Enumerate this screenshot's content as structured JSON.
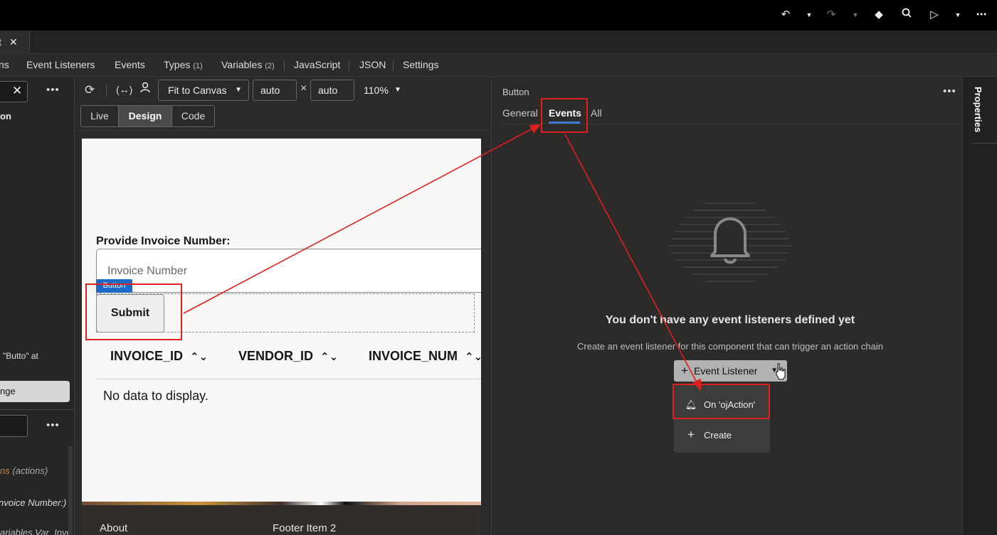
{
  "topbar": {
    "icons": [
      "undo-icon",
      "undo-caret-icon",
      "redo-icon",
      "redo-caret-icon",
      "git-icon",
      "search-icon",
      "run-icon",
      "run-caret-icon",
      "more-icon"
    ]
  },
  "file_tab": {
    "name": "t",
    "close": "✕"
  },
  "nav": {
    "items": [
      {
        "label": "ns"
      },
      {
        "label": "Event Listeners"
      },
      {
        "label": "Events"
      },
      {
        "label": "Types",
        "count": "(1)"
      },
      {
        "label": "Variables",
        "count": "(2)"
      },
      {
        "label": "JavaScript"
      },
      {
        "label": "JSON"
      },
      {
        "label": "Settings"
      }
    ]
  },
  "left_panel": {
    "heading": "on",
    "selection_text": "\"Butto\" at",
    "button_label": "nge",
    "actions_label": "ns",
    "actions_hint": "(actions)",
    "invoice_item": "nvoice Number:)",
    "variables_item": "ariables.Var_Invo"
  },
  "canvas_toolbar": {
    "fit_label": "Fit to Canvas",
    "width_value": "auto",
    "times": "×",
    "height_value": "auto",
    "zoom": "110%",
    "modes": [
      "Live",
      "Design",
      "Code"
    ],
    "active_mode": "Design"
  },
  "page": {
    "label": "Provide Invoice Number:",
    "input_placeholder": "Invoice Number",
    "badge": "Button",
    "submit": "Submit",
    "columns": [
      "INVOICE_ID",
      "VENDOR_ID",
      "INVOICE_NUM"
    ],
    "no_data": "No data to display.",
    "footer": [
      "About",
      "Footer Item 2"
    ]
  },
  "right_panel": {
    "title": "Button",
    "tabs": [
      "General",
      "Events",
      "All"
    ],
    "active_tab": "Events",
    "empty_title": "You don't have any event listeners defined yet",
    "empty_desc": "Create an event listener for this component that can trigger an action chain",
    "add_button": "Event Listener",
    "menu": [
      {
        "label": "On 'ojAction'",
        "icon": "bell-icon"
      },
      {
        "label": "Create",
        "icon": "plus-icon"
      }
    ]
  },
  "side_tab": {
    "label": "Properties"
  },
  "colors": {
    "annotation": "#e01f1f",
    "accent": "#3d7ad6",
    "badge": "#1b6ac7"
  }
}
